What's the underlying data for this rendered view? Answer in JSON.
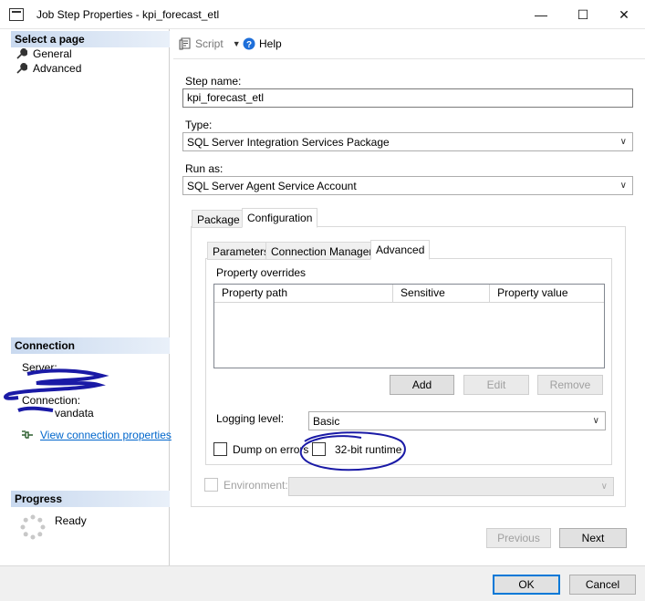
{
  "window": {
    "title": "Job Step Properties - kpi_forecast_etl",
    "minimize": "—",
    "maximize": "☐",
    "close": "✕"
  },
  "sidebar": {
    "select_page_header": "Select a page",
    "pages": [
      {
        "label": "General",
        "icon": "wrench-icon"
      },
      {
        "label": "Advanced",
        "icon": "wrench-icon"
      }
    ],
    "connection_header": "Connection",
    "server_label": "Server:",
    "connection_label": "Connection:",
    "connection_value": "vandata",
    "view_connection_link": "View connection properties",
    "progress_header": "Progress",
    "progress_status": "Ready"
  },
  "toolbar": {
    "script_label": "Script",
    "help_label": "Help"
  },
  "form": {
    "step_name_label": "Step name:",
    "step_name_value": "kpi_forecast_etl",
    "type_label": "Type:",
    "type_value": "SQL Server Integration Services Package",
    "run_as_label": "Run as:",
    "run_as_value": "SQL Server Agent Service Account"
  },
  "outer_tabs": [
    {
      "label": "Package",
      "active": false
    },
    {
      "label": "Configuration",
      "active": true
    }
  ],
  "inner_tabs": [
    {
      "label": "Parameters",
      "active": false
    },
    {
      "label": "Connection Managers",
      "active": false
    },
    {
      "label": "Advanced",
      "active": true
    }
  ],
  "advanced": {
    "property_overrides_label": "Property overrides",
    "columns": [
      "Property path",
      "Sensitive",
      "Property value"
    ],
    "add_button": "Add",
    "edit_button": "Edit",
    "remove_button": "Remove",
    "logging_level_label": "Logging level:",
    "logging_level_value": "Basic",
    "dump_on_errors_label": "Dump on errors",
    "runtime_32bit_label": "32-bit runtime"
  },
  "environment": {
    "label": "Environment:",
    "value": ""
  },
  "nav_buttons": {
    "previous": "Previous",
    "next": "Next"
  },
  "dialog_buttons": {
    "ok": "OK",
    "cancel": "Cancel"
  },
  "colors": {
    "accent": "#0078d7",
    "annotation": "#1a1aa6",
    "link": "#0066cc"
  }
}
